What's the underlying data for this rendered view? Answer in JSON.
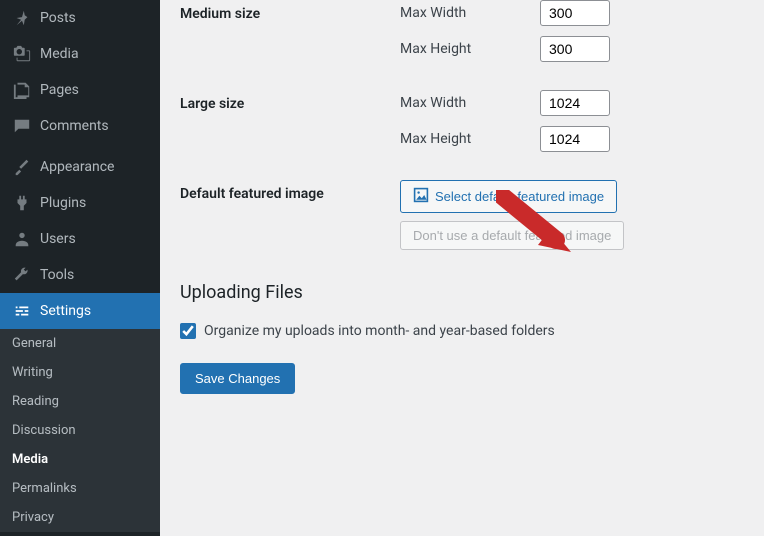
{
  "sidebar": {
    "posts": "Posts",
    "media": "Media",
    "pages": "Pages",
    "comments": "Comments",
    "appearance": "Appearance",
    "plugins": "Plugins",
    "users": "Users",
    "tools": "Tools",
    "settings": "Settings"
  },
  "submenu": {
    "general": "General",
    "writing": "Writing",
    "reading": "Reading",
    "discussion": "Discussion",
    "media": "Media",
    "permalinks": "Permalinks",
    "privacy": "Privacy"
  },
  "settings": {
    "medium_label": "Medium size",
    "large_label": "Large size",
    "dfi_label": "Default featured image",
    "max_width": "Max Width",
    "max_height": "Max Height",
    "medium_w": "300",
    "medium_h": "300",
    "large_w": "1024",
    "large_h": "1024",
    "select_dfi": "Select default featured image",
    "remove_dfi": "Don't use a default featured image",
    "uploading_heading": "Uploading Files",
    "organize": "Organize my uploads into month- and year-based folders",
    "save": "Save Changes"
  }
}
